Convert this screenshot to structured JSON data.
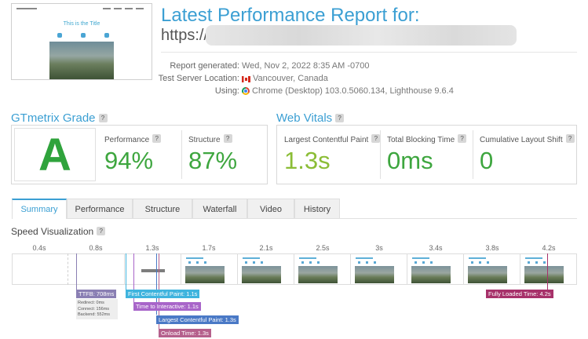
{
  "header": {
    "title": "Latest Performance Report for:",
    "url_prefix": "https://",
    "thumbnail_title": "This is the Title"
  },
  "meta": {
    "report_generated_label": "Report generated:",
    "report_generated_value": "Wed, Nov 2, 2022 8:35 AM -0700",
    "server_label": "Test Server Location:",
    "server_value": "Vancouver, Canada",
    "using_label": "Using:",
    "using_value": "Chrome (Desktop) 103.0.5060.134, Lighthouse 9.6.4"
  },
  "grade": {
    "heading": "GTmetrix Grade",
    "letter": "A",
    "performance_label": "Performance",
    "performance_value": "94%",
    "structure_label": "Structure",
    "structure_value": "87%"
  },
  "vitals": {
    "heading": "Web Vitals",
    "lcp_label": "Largest Contentful Paint",
    "lcp_value": "1.3s",
    "tbt_label": "Total Blocking Time",
    "tbt_value": "0ms",
    "cls_label": "Cumulative Layout Shift",
    "cls_value": "0"
  },
  "tabs": [
    "Summary",
    "Performance",
    "Structure",
    "Waterfall",
    "Video",
    "History"
  ],
  "speed": {
    "heading": "Speed Visualization",
    "ticks": [
      "0.4s",
      "0.8s",
      "1.3s",
      "1.7s",
      "2.1s",
      "2.5s",
      "3s",
      "3.4s",
      "3.8s",
      "4.2s"
    ],
    "ttfb": "TTFB: 708ms",
    "ttfb_redirect": "Redirect: 0ms",
    "ttfb_connect": "Connect: 156ms",
    "ttfb_backend": "Backend: 552ms",
    "fcp": "First Contentful Paint: 1.1s",
    "tti": "Time to Interactive: 1.1s",
    "lcp": "Largest Contentful Paint: 1.3s",
    "onload": "Onload Time: 1.3s",
    "fully_loaded": "Fully Loaded Time: 4.2s"
  },
  "colors": {
    "accent": "#3b9fd3",
    "grade_green": "#2fa33c",
    "ttfb": "#8a7fb3",
    "fcp": "#3fb4de",
    "tti": "#a865c9",
    "lcp": "#4a79c6",
    "onload": "#b5608c",
    "fully_loaded": "#a7316a"
  },
  "icons": {
    "flag": "canada-flag-icon",
    "browser": "chrome-icon",
    "help": "help-icon"
  }
}
